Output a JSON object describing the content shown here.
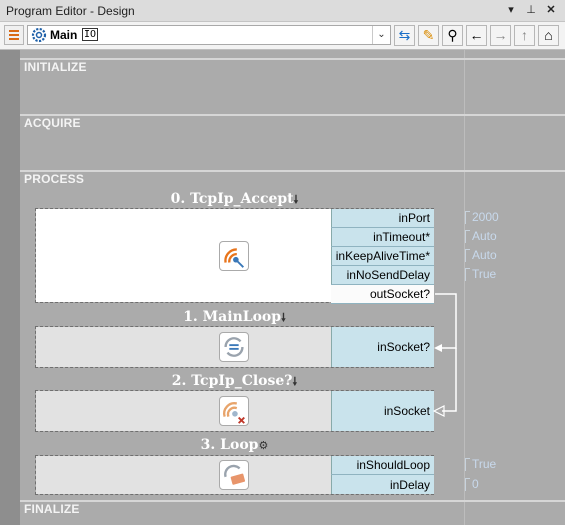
{
  "window": {
    "title": "Program Editor - Design"
  },
  "toolbar": {
    "program_name": "Main",
    "io_badge": "IO",
    "buttons": [
      "menu-icon",
      "swap-icon",
      "edit-icon",
      "search-icon",
      "back-arrow-icon",
      "forward-arrow-icon",
      "up-arrow-icon",
      "home-icon"
    ]
  },
  "sections": {
    "initialize": "INITIALIZE",
    "acquire": "ACQUIRE",
    "process": "PROCESS",
    "finalize": "FINALIZE"
  },
  "steps": [
    {
      "title": "0. TcpIp_Accept",
      "marker": "🠗",
      "inputs": [
        "inPort",
        "inTimeout*",
        "inKeepAliveTime*",
        "inNoSendDelay"
      ],
      "values": [
        "2000",
        "Auto",
        "Auto",
        "True"
      ],
      "outputs": [
        "outSocket?"
      ]
    },
    {
      "title": "1. MainLoop",
      "marker": "🠗",
      "inputs": [
        "inSocket?"
      ]
    },
    {
      "title": "2. TcpIp_Close?",
      "marker": "🠗",
      "inputs": [
        "inSocket"
      ]
    },
    {
      "title": "3. Loop",
      "marker": "⚙",
      "inputs": [
        "inShouldLoop",
        "inDelay"
      ],
      "values": [
        "True",
        "0"
      ]
    }
  ],
  "colors": {
    "canvas": "#ababab",
    "port_bg": "#c9e3ec",
    "value_text": "#c8d9ec",
    "section_text": "#f4f4f4"
  }
}
